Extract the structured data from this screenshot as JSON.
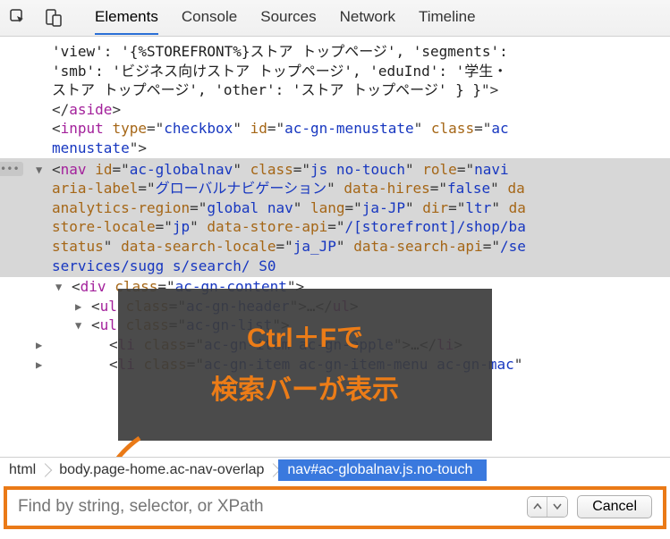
{
  "tabs": {
    "elements": "Elements",
    "console": "Console",
    "sources": "Sources",
    "network": "Network",
    "timeline": "Timeline"
  },
  "dom": {
    "line1": "'view': '{%STOREFRONT%}ストア トップページ', 'segments':",
    "line2": "'smb': 'ビジネス向けストア トップページ', 'eduInd': '学生・",
    "line3_text": "ストア トップページ', 'other': 'ストア トップページ' } }",
    "aside_close": "aside",
    "input_tag": "input",
    "input_attrs": {
      "type_k": "type",
      "type_v": "checkbox",
      "id_k": "id",
      "id_v": "ac-gn-menustate",
      "class_k": "class",
      "class_v": "ac"
    },
    "input_cont": "menustate",
    "nav_tag": "nav",
    "nav_attrs": {
      "id_k": "id",
      "id_v": "ac-globalnav",
      "class_k": "class",
      "class_v": "js no-touch",
      "role_k": "role",
      "role_v": "navi"
    },
    "nav_l2": {
      "aria_k": "aria-label",
      "aria_v": "グローバルナビゲーション",
      "hires_k": "data-hires",
      "hires_v": "false",
      "da": "da"
    },
    "nav_l3": {
      "ar_k": "analytics-region",
      "ar_v": "global nav",
      "lang_k": "lang",
      "lang_v": "ja-JP",
      "dir_k": "dir",
      "dir_v": "ltr",
      "da": "da"
    },
    "nav_l4": {
      "sl_k": "store-locale",
      "sl_v": "jp",
      "sa_k": "data-store-api",
      "sa_v": "/[storefront]/shop/ba"
    },
    "nav_l5": {
      "st_k": "status",
      "dl_k": "data-search-locale",
      "dl_v": "ja_JP",
      "ds_k": "data-search-api",
      "ds_v": "/se"
    },
    "nav_l6": "services/sugg     s/search/        S0",
    "div_tag": "div",
    "div_class_k": "class",
    "div_class_v": "ac-gn-content",
    "ul_tag": "ul",
    "ul1_class_v": "ac-gn-header",
    "ul_close": "ul",
    "ul2_class_v": "ac-gn-list",
    "li_tag": "li",
    "li1_class_v": "ac-gn-item ac-gn-apple",
    "li_dots": "…",
    "li_close": "li",
    "li2_class_v": "ac-gn-item ac-gn-item-menu ac-gn-mac",
    "class_k": "class"
  },
  "annotation": {
    "line1": "Ctrl＋Fで",
    "line2": "検索バーが表示"
  },
  "breadcrumbs": {
    "html": "html",
    "body": "body.page-home.ac-nav-overlap",
    "nav": "nav#ac-globalnav.js.no-touch"
  },
  "search": {
    "placeholder": "Find by string, selector, or XPath",
    "cancel": "Cancel"
  }
}
